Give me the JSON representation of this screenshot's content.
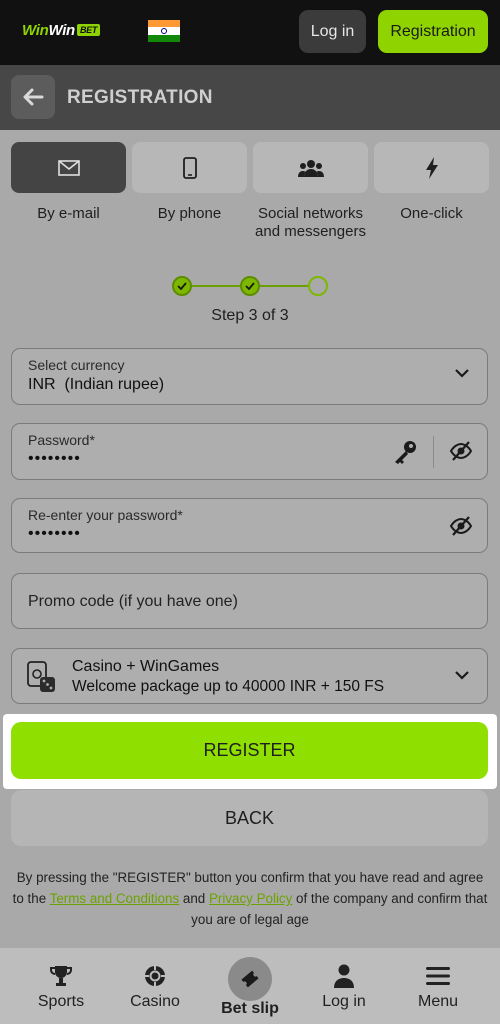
{
  "header": {
    "logo_win1": "Win",
    "logo_win2": "Win",
    "logo_bet": "BET",
    "login_label": "Log in",
    "registration_label": "Registration"
  },
  "page": {
    "title": "REGISTRATION"
  },
  "tabs": [
    {
      "label": "By e-mail",
      "icon": "envelope-icon",
      "active": true
    },
    {
      "label": "By phone",
      "icon": "phone-icon",
      "active": false
    },
    {
      "label": "Social networks and messengers",
      "icon": "users-icon",
      "active": false
    },
    {
      "label": "One-click",
      "icon": "lightning-icon",
      "active": false
    }
  ],
  "stepper": {
    "text": "Step 3 of 3",
    "current": 3,
    "total": 3
  },
  "form": {
    "currency": {
      "label": "Select currency",
      "code": "INR",
      "name": "(Indian rupee)"
    },
    "password": {
      "label": "Password*",
      "value": "••••••••"
    },
    "repassword": {
      "label": "Re-enter your password*",
      "value": "••••••••"
    },
    "promo": {
      "placeholder": "Promo code (if you have one)"
    },
    "bonus": {
      "title": "Casino + WinGames",
      "subtitle": "Welcome package up to 40000 INR + 150 FS"
    }
  },
  "buttons": {
    "register": "REGISTER",
    "back": "BACK"
  },
  "legal": {
    "part1": "By pressing the \"REGISTER\" button you confirm that you have read and agree to the ",
    "terms": "Terms and Conditions",
    "and": " and ",
    "privacy": "Privacy Policy",
    "part2": " of the company and confirm that you are of legal age"
  },
  "nav": {
    "sports": "Sports",
    "casino": "Casino",
    "betslip": "Bet slip",
    "login": "Log in",
    "menu": "Menu"
  },
  "colors": {
    "accent": "#8fd400",
    "register_button": "#8fe000",
    "topbar": "#111111",
    "headerbar": "#474747"
  }
}
